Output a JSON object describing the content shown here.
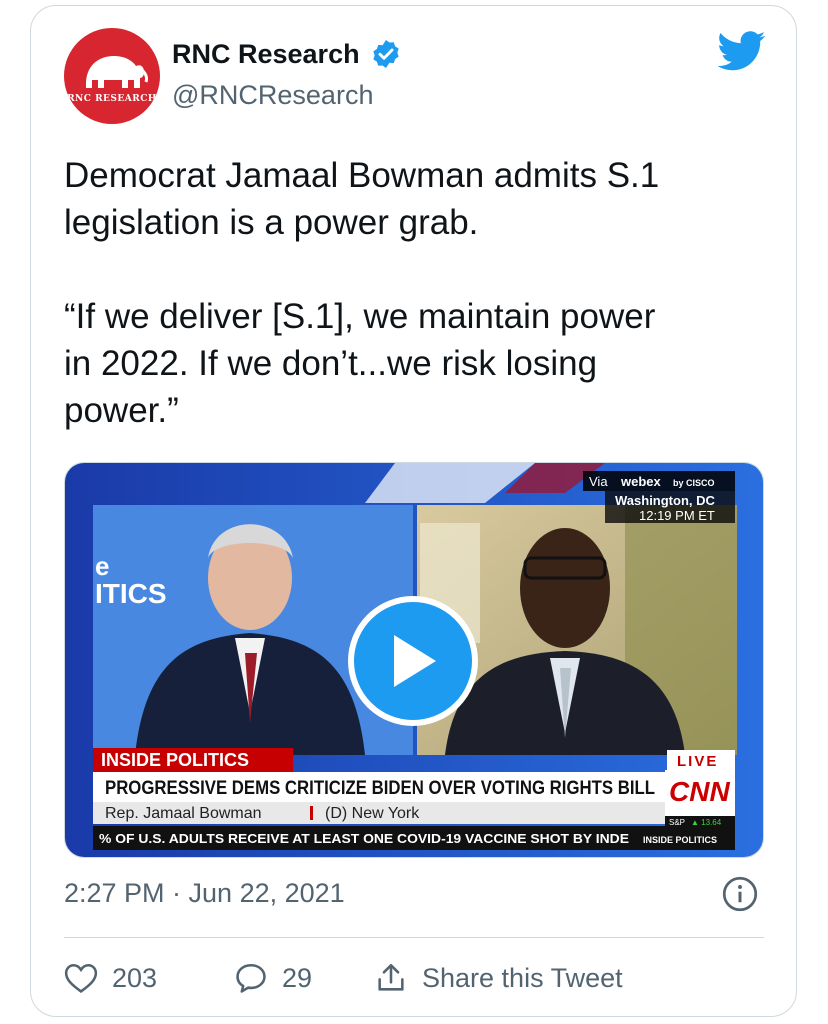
{
  "tweet": {
    "author_name": "RNC Research",
    "author_handle": "@RNCResearch",
    "avatar_text": "RNC RESEARCH",
    "text_lines_1": [
      "Democrat Jamaal Bowman admits S.1",
      "legislation is a power grab."
    ],
    "text_lines_2": [
      "“If we deliver [S.1], we maintain power",
      "in 2022. If we don’t...we risk losing",
      "power.”"
    ],
    "timestamp": "2:27 PM · Jun 22, 2021",
    "likes": "203",
    "replies": "29",
    "share_label": "Share this Tweet"
  },
  "video": {
    "via": "Via",
    "webex": "webex",
    "by_cisco": "by CISCO",
    "location": "Washington, DC",
    "time": "12:19 PM ET",
    "show_partial_1": "e",
    "show_partial_2": "ITICS",
    "segment": "INSIDE POLITICS",
    "headline": "PROGRESSIVE DEMS CRITICIZE BIDEN OVER VOTING RIGHTS BILL",
    "guest_name": "Rep. Jamaal Bowman",
    "guest_party": "(D) New York",
    "live": "LIVE",
    "network": "CNN",
    "ticker": "% OF U.S. ADULTS RECEIVE AT LEAST ONE COVID-19 VACCINE SHOT BY INDE",
    "ticker_show": "INSIDE POLITICS",
    "market_label": "S&P",
    "market_value": "▲ 13.64"
  },
  "colors": {
    "twitter_blue": "#1d9bf0",
    "rnc_red": "#d7262f",
    "cnn_red": "#cc0000",
    "secondary_text": "#536471"
  },
  "icons": {
    "bird": "twitter-bird-icon",
    "verified": "verified-badge-icon",
    "info": "info-icon",
    "like": "heart-icon",
    "reply": "reply-bubble-icon",
    "share": "share-icon",
    "play": "play-icon"
  }
}
